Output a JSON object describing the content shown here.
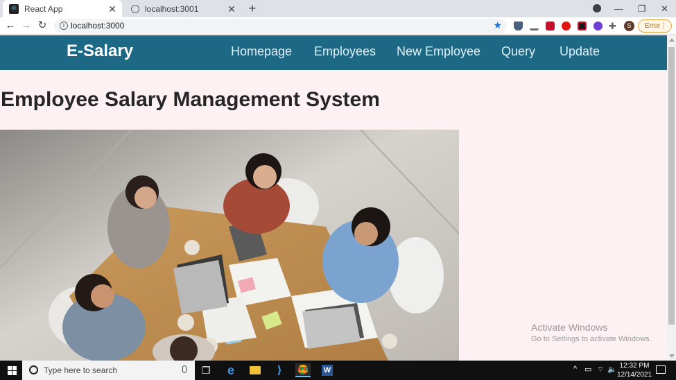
{
  "browser": {
    "tabs": [
      {
        "title": "React App",
        "active": true,
        "icon": "react-icon"
      },
      {
        "title": "localhost:3001",
        "active": false,
        "icon": "globe-icon"
      }
    ],
    "new_tab_label": "+",
    "url": "localhost:3000",
    "profile_initial": "S",
    "error_label": "Error"
  },
  "app": {
    "brand": "E-Salary",
    "nav": [
      {
        "label": "Homepage"
      },
      {
        "label": "Employees"
      },
      {
        "label": "New Employee"
      },
      {
        "label": "Query"
      },
      {
        "label": "Update"
      }
    ],
    "heading": "Employee Salary Management System",
    "colors": {
      "navbar": "#1d6985",
      "page_bg": "#fdf1f4"
    }
  },
  "watermark": {
    "line1": "Activate Windows",
    "line2": "Go to Settings to activate Windows."
  },
  "taskbar": {
    "search_placeholder": "Type here to search",
    "time": "12:32 PM",
    "date": "12/14/2021"
  }
}
